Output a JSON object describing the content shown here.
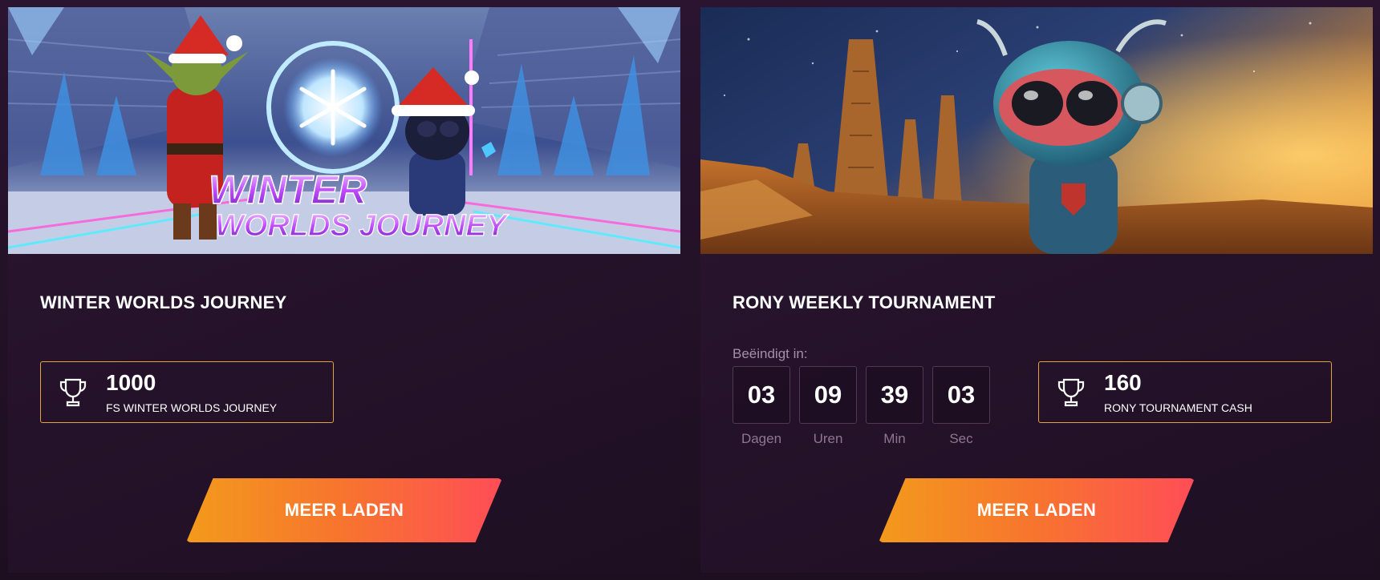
{
  "cards": [
    {
      "title": "WINTER WORLDS JOURNEY",
      "banner": {
        "logo_line1": "WINTER",
        "logo_line2": "WORLDS JOURNEY",
        "characters": [
          "goblin-santa",
          "robot-santa"
        ]
      },
      "prize": {
        "icon": "trophy-icon",
        "value": "1000",
        "label": "FS WINTER WORLDS JOURNEY"
      },
      "cta_label": "MEER LADEN"
    },
    {
      "title": "RONY WEEKLY TOURNAMENT",
      "banner": {
        "characters": [
          "alien-robot"
        ]
      },
      "countdown": {
        "label": "Beëindigt in:",
        "units": [
          {
            "value": "03",
            "caption": "Dagen"
          },
          {
            "value": "09",
            "caption": "Uren"
          },
          {
            "value": "39",
            "caption": "Min"
          },
          {
            "value": "03",
            "caption": "Sec"
          }
        ]
      },
      "prize": {
        "icon": "trophy-icon",
        "value": "160",
        "label": "RONY TOURNAMENT CASH"
      },
      "cta_label": "MEER LADEN"
    }
  ],
  "colors": {
    "accent_border": "#e3a23a",
    "button_gradient_start": "#f39a1c",
    "button_gradient_end": "#ff4d57",
    "card_background": "#2c1730"
  }
}
